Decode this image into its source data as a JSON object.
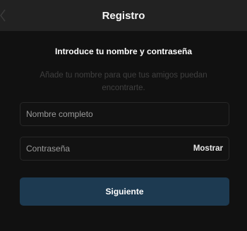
{
  "header": {
    "title": "Registro"
  },
  "form": {
    "heading": "Introduce tu nombre y contraseña",
    "description": "Añade tu nombre para que tus amigos puedan encontrarte.",
    "full_name_placeholder": "Nombre completo",
    "full_name_value": "",
    "password_placeholder": "Contraseña",
    "password_value": "",
    "show_password_label": "Mostrar",
    "next_label": "Siguiente"
  },
  "colors": {
    "header_bg": "#222222",
    "page_bg": "#111111",
    "field_border": "#272727",
    "next_button_bg": "#1d3a51",
    "muted_text": "#3f3f3f"
  }
}
